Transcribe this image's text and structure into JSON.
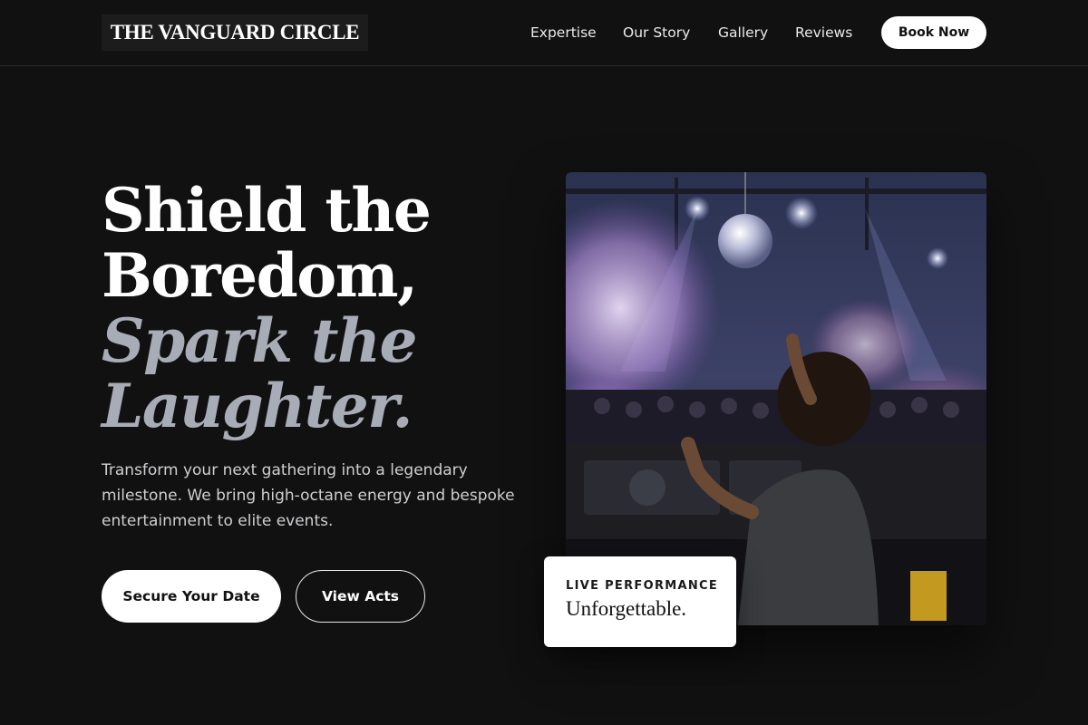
{
  "brand": {
    "logo_text": "THE VANGUARD CIRCLE"
  },
  "nav": {
    "links": [
      "Expertise",
      "Our Story",
      "Gallery",
      "Reviews"
    ],
    "cta_label": "Book Now"
  },
  "hero": {
    "headline_line1": "Shield the",
    "headline_line2": "Boredom,",
    "headline_line3": "Spark the",
    "headline_line4": "Laughter.",
    "description": "Transform your next gathering into a legendary milestone. We bring high-octane energy and bespoke entertainment to elite events.",
    "primary_cta": "Secure Your Date",
    "secondary_cta": "View Acts",
    "image_icon": "dj-performance-photo",
    "badge_eyebrow": "LIVE PERFORMANCE",
    "badge_title": "Unforgettable."
  },
  "colors": {
    "background": "#111112",
    "accent_text": "#a8acb6",
    "button_light": "#ffffff"
  }
}
